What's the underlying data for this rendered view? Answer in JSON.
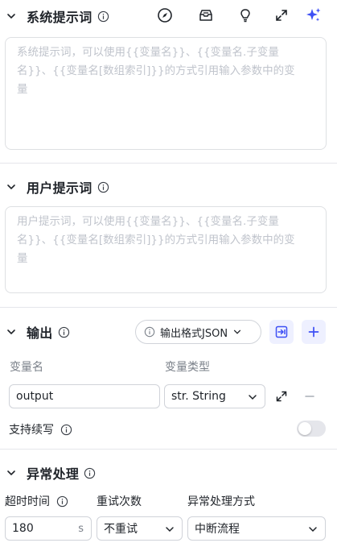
{
  "system_prompt": {
    "title": "系统提示词",
    "placeholder_lines": [
      "系统提示词，可以使用{{变量名}}、{{变量名.子变量",
      "名}}、{{变量名[数组索引]}}的方式引用输入参数中的变",
      "量"
    ]
  },
  "user_prompt": {
    "title": "用户提示词",
    "placeholder_lines": [
      "用户提示词，可以使用{{变量名}}、{{变量名.子变量",
      "名}}、{{变量名[数组索引]}}的方式引用输入参数中的变",
      "量"
    ]
  },
  "output": {
    "title": "输出",
    "format_button": "输出格式JSON",
    "col_name": "变量名",
    "col_type": "变量类型",
    "var_name": "output",
    "var_type": "str. String",
    "continue_label": "支持续写"
  },
  "exception": {
    "title": "异常处理",
    "timeout_label": "超时时间",
    "retry_label": "重试次数",
    "method_label": "异常处理方式",
    "timeout_value": "180",
    "timeout_unit": "s",
    "retry_value": "不重试",
    "method_value": "中断流程"
  },
  "icons": {
    "accent": "#3d4ff5",
    "toolbar": [
      "compass-icon",
      "inbox-icon",
      "lightbulb-icon",
      "expand-icon",
      "sparkle-icon"
    ]
  }
}
